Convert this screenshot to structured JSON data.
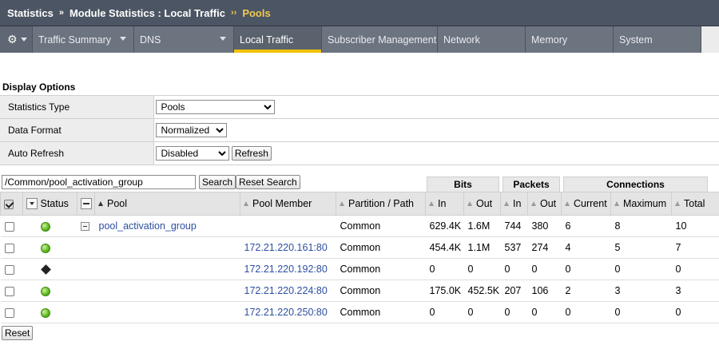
{
  "breadcrumb": {
    "part1": "Statistics",
    "sep1": "»",
    "part2": "Module Statistics : Local Traffic",
    "sep2": "››",
    "current": "Pools"
  },
  "nav": {
    "gear_icon": "gear-icon",
    "items": [
      "Traffic Summary",
      "DNS",
      "Local Traffic",
      "Subscriber Management",
      "Network",
      "Memory",
      "System"
    ]
  },
  "display_options": {
    "title": "Display Options",
    "stats_type_label": "Statistics Type",
    "stats_type_value": "Pools",
    "data_format_label": "Data Format",
    "data_format_value": "Normalized",
    "auto_refresh_label": "Auto Refresh",
    "auto_refresh_value": "Disabled",
    "refresh_button": "Refresh"
  },
  "filter": {
    "value": "/Common/pool_activation_group",
    "search_button": "Search",
    "reset_search_button": "Reset Search"
  },
  "groups": {
    "bits": "Bits",
    "packets": "Packets",
    "connections": "Connections"
  },
  "columns": {
    "status": "Status",
    "pool": "Pool",
    "pool_member": "Pool Member",
    "partition": "Partition / Path",
    "bits_in": "In",
    "bits_out": "Out",
    "pkts_in": "In",
    "pkts_out": "Out",
    "current": "Current",
    "maximum": "Maximum",
    "total": "Total"
  },
  "rows": [
    {
      "status": "available",
      "pool": "pool_activation_group",
      "member": "",
      "partition": "Common",
      "bits_in": "629.4K",
      "bits_out": "1.6M",
      "pkts_in": "744",
      "pkts_out": "380",
      "current": "6",
      "maximum": "8",
      "total": "10"
    },
    {
      "status": "available",
      "pool": "",
      "member": "172.21.220.161:80",
      "partition": "Common",
      "bits_in": "454.4K",
      "bits_out": "1.1M",
      "pkts_in": "537",
      "pkts_out": "274",
      "current": "4",
      "maximum": "5",
      "total": "7"
    },
    {
      "status": "offline",
      "pool": "",
      "member": "172.21.220.192:80",
      "partition": "Common",
      "bits_in": "0",
      "bits_out": "0",
      "pkts_in": "0",
      "pkts_out": "0",
      "current": "0",
      "maximum": "0",
      "total": "0"
    },
    {
      "status": "available",
      "pool": "",
      "member": "172.21.220.224:80",
      "partition": "Common",
      "bits_in": "175.0K",
      "bits_out": "452.5K",
      "pkts_in": "207",
      "pkts_out": "106",
      "current": "2",
      "maximum": "3",
      "total": "3"
    },
    {
      "status": "available",
      "pool": "",
      "member": "172.21.220.250:80",
      "partition": "Common",
      "bits_in": "0",
      "bits_out": "0",
      "pkts_in": "0",
      "pkts_out": "0",
      "current": "0",
      "maximum": "0",
      "total": "0"
    }
  ],
  "footer": {
    "reset_button": "Reset"
  },
  "colors": {
    "header_bg": "#4c5563",
    "nav_bg": "#6c7480",
    "active_tab_underline": "#f2c100",
    "breadcrumb_current": "#f2c94c",
    "link": "#2d4fa0"
  }
}
